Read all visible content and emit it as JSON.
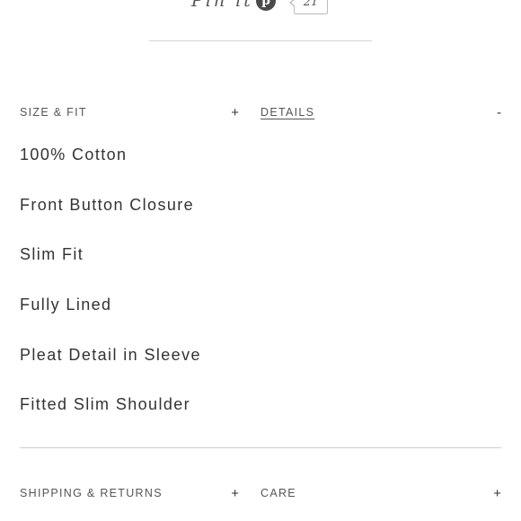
{
  "pin": {
    "label": "Pin it",
    "icon_glyph": "p",
    "count": "21"
  },
  "accordion": {
    "size_fit": {
      "label": "SIZE & FIT",
      "toggle": "+"
    },
    "details": {
      "label": "DETAILS",
      "toggle": "-"
    },
    "shipping": {
      "label": "SHIPPING & RETURNS",
      "toggle": "+"
    },
    "care": {
      "label": "CARE",
      "toggle": "+"
    }
  },
  "details_items": [
    "100% Cotton",
    "Front Button Closure",
    "Slim Fit",
    "Fully Lined",
    "Pleat Detail in Sleeve",
    "Fitted Slim Shoulder"
  ]
}
